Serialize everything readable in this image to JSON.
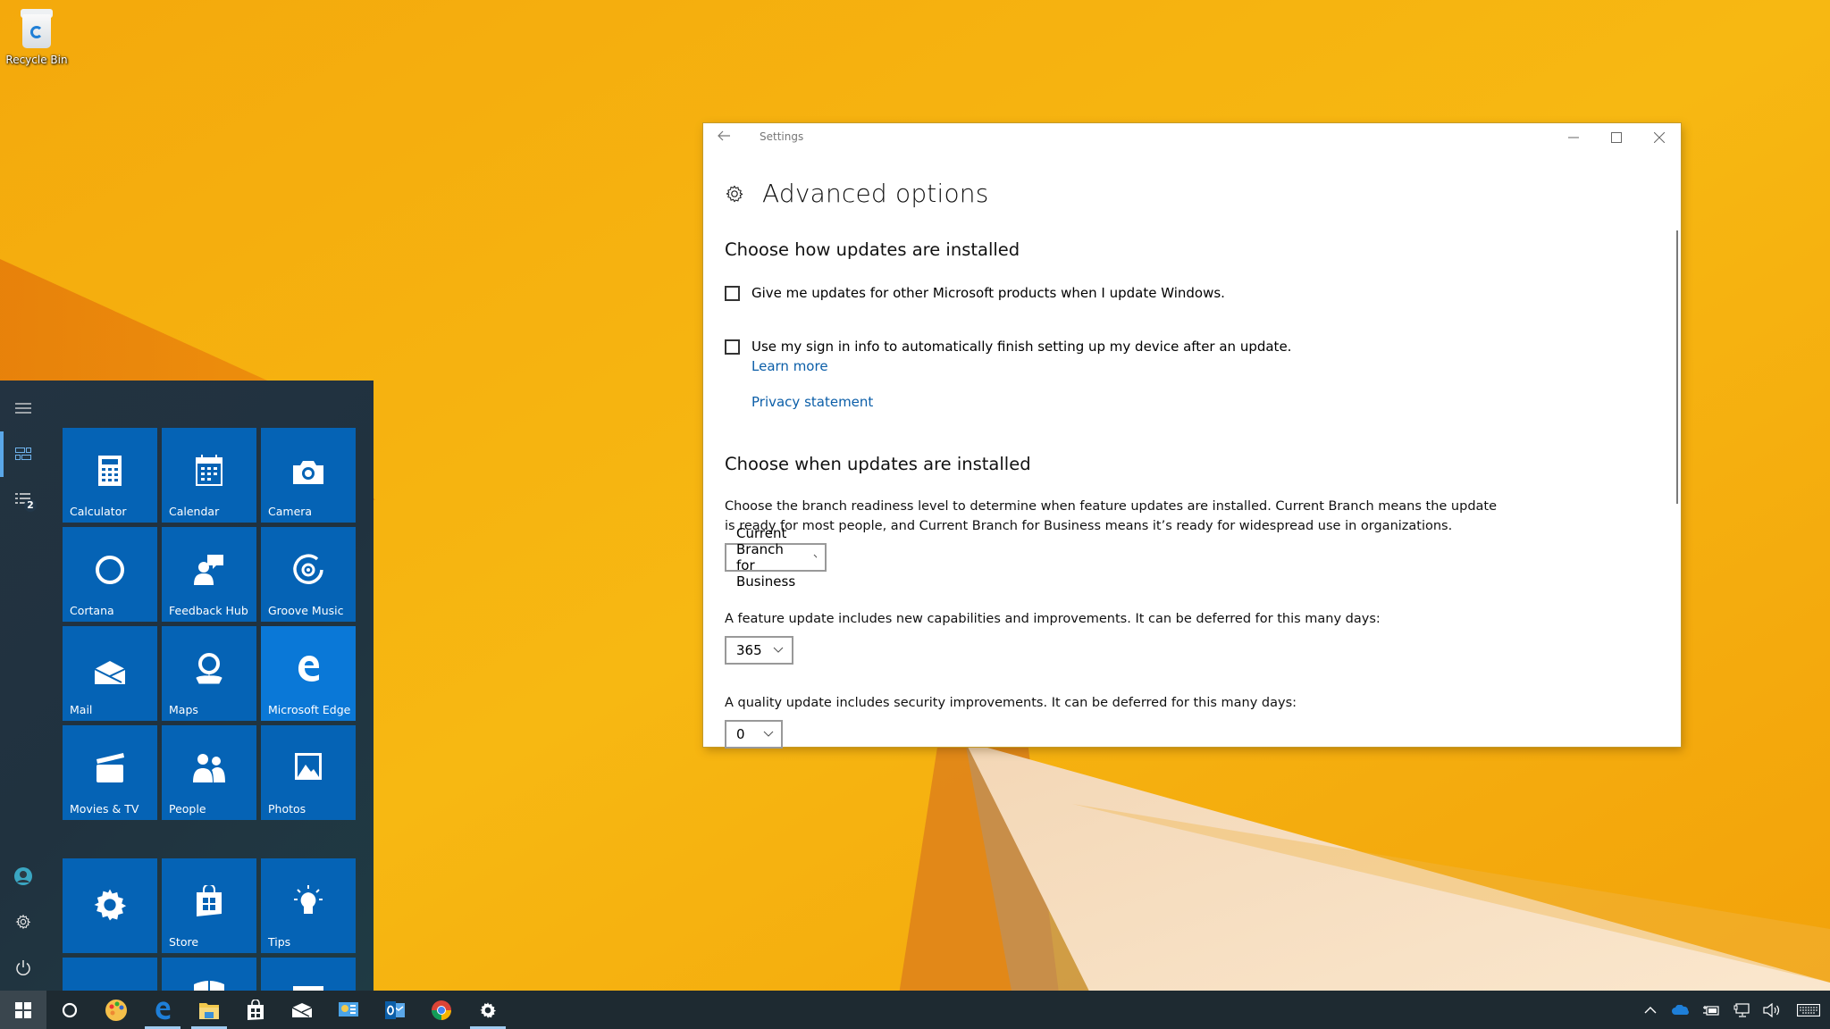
{
  "desktop": {
    "icons": [
      {
        "label": "Recycle Bin",
        "icon": "recycle-bin-icon"
      }
    ]
  },
  "settings_window": {
    "app_title": "Settings",
    "back_icon": "arrow-left-icon",
    "controls": {
      "minimize": "minimize-icon",
      "maximize": "maximize-icon",
      "close": "close-icon"
    },
    "page_icon": "gear-icon",
    "page_title": "Advanced options",
    "section_how": {
      "title": "Choose how updates are installed",
      "checkboxes": [
        {
          "label": "Give me updates for other Microsoft products when I update Windows.",
          "checked": false
        },
        {
          "label": "Use my sign in info to automatically finish setting up my device after an update.",
          "checked": false
        }
      ],
      "learn_more": "Learn more",
      "privacy_statement": "Privacy statement"
    },
    "section_when": {
      "title": "Choose when updates are installed",
      "description": "Choose the branch readiness level to determine when feature updates are installed. Current Branch means the update is ready for most people, and Current Branch for Business means it’s ready for widespread use in organizations.",
      "branch_select": {
        "value": "Current Branch for Business"
      },
      "feature_label": "A feature update includes new capabilities and improvements. It can be deferred for this many days:",
      "feature_select": {
        "value": "365"
      },
      "quality_label": "A quality update includes security improvements. It can be deferred for this many days:",
      "quality_select": {
        "value": "0"
      }
    }
  },
  "start_menu": {
    "rail": {
      "menu_icon": "hamburger-icon",
      "tiles_view_icon": "tiles-view-icon",
      "all_apps_icon": "all-apps-list-icon",
      "all_apps_badge": "2",
      "user_icon": "user-avatar-icon",
      "settings_icon": "settings-icon",
      "power_icon": "power-icon"
    },
    "tiles": [
      {
        "label": "Calculator",
        "icon": "calculator-icon"
      },
      {
        "label": "Calendar",
        "icon": "calendar-icon"
      },
      {
        "label": "Camera",
        "icon": "camera-icon"
      },
      {
        "label": "Cortana",
        "icon": "cortana-icon"
      },
      {
        "label": "Feedback Hub",
        "icon": "feedback-hub-icon"
      },
      {
        "label": "Groove Music",
        "icon": "groove-music-icon"
      },
      {
        "label": "Mail",
        "icon": "mail-icon"
      },
      {
        "label": "Maps",
        "icon": "maps-icon"
      },
      {
        "label": "Microsoft Edge",
        "icon": "edge-icon"
      },
      {
        "label": "Movies & TV",
        "icon": "movies-tv-icon"
      },
      {
        "label": "People",
        "icon": "people-icon"
      },
      {
        "label": "Photos",
        "icon": "photos-icon"
      }
    ],
    "tiles_group2": [
      {
        "label": "",
        "icon": "settings-gear-icon"
      },
      {
        "label": "Store",
        "icon": "store-icon"
      },
      {
        "label": "Tips",
        "icon": "lightbulb-icon"
      }
    ]
  },
  "taskbar": {
    "items": [
      {
        "name": "start",
        "icon": "windows-logo-icon"
      },
      {
        "name": "cortana",
        "icon": "cortana-circle-icon"
      },
      {
        "name": "paint",
        "icon": "paint-palette-icon"
      },
      {
        "name": "edge",
        "icon": "edge-icon",
        "running": true
      },
      {
        "name": "file-explorer",
        "icon": "folder-icon",
        "running": true
      },
      {
        "name": "store",
        "icon": "store-icon"
      },
      {
        "name": "mail",
        "icon": "mail-icon"
      },
      {
        "name": "control-panel",
        "icon": "control-panel-icon"
      },
      {
        "name": "outlook",
        "icon": "outlook-icon"
      },
      {
        "name": "chrome",
        "icon": "chrome-icon"
      },
      {
        "name": "settings",
        "icon": "settings-gear-icon",
        "running": true
      }
    ],
    "tray": [
      {
        "name": "show-hidden",
        "icon": "chevron-up-icon"
      },
      {
        "name": "onedrive",
        "icon": "cloud-icon"
      },
      {
        "name": "power",
        "icon": "battery-icon"
      },
      {
        "name": "network",
        "icon": "network-icon"
      },
      {
        "name": "volume",
        "icon": "speaker-icon"
      },
      {
        "name": "touch-keyboard",
        "icon": "keyboard-icon"
      }
    ]
  },
  "colors": {
    "link": "#0b5ea8",
    "tile": "#0563b5",
    "tile_highlight": "#0a78d7",
    "start_bg": "#233341",
    "taskbar_bg": "#1e2a31",
    "wallpaper_main": "#f5b10f",
    "accent_underline": "#9fcbf0"
  }
}
